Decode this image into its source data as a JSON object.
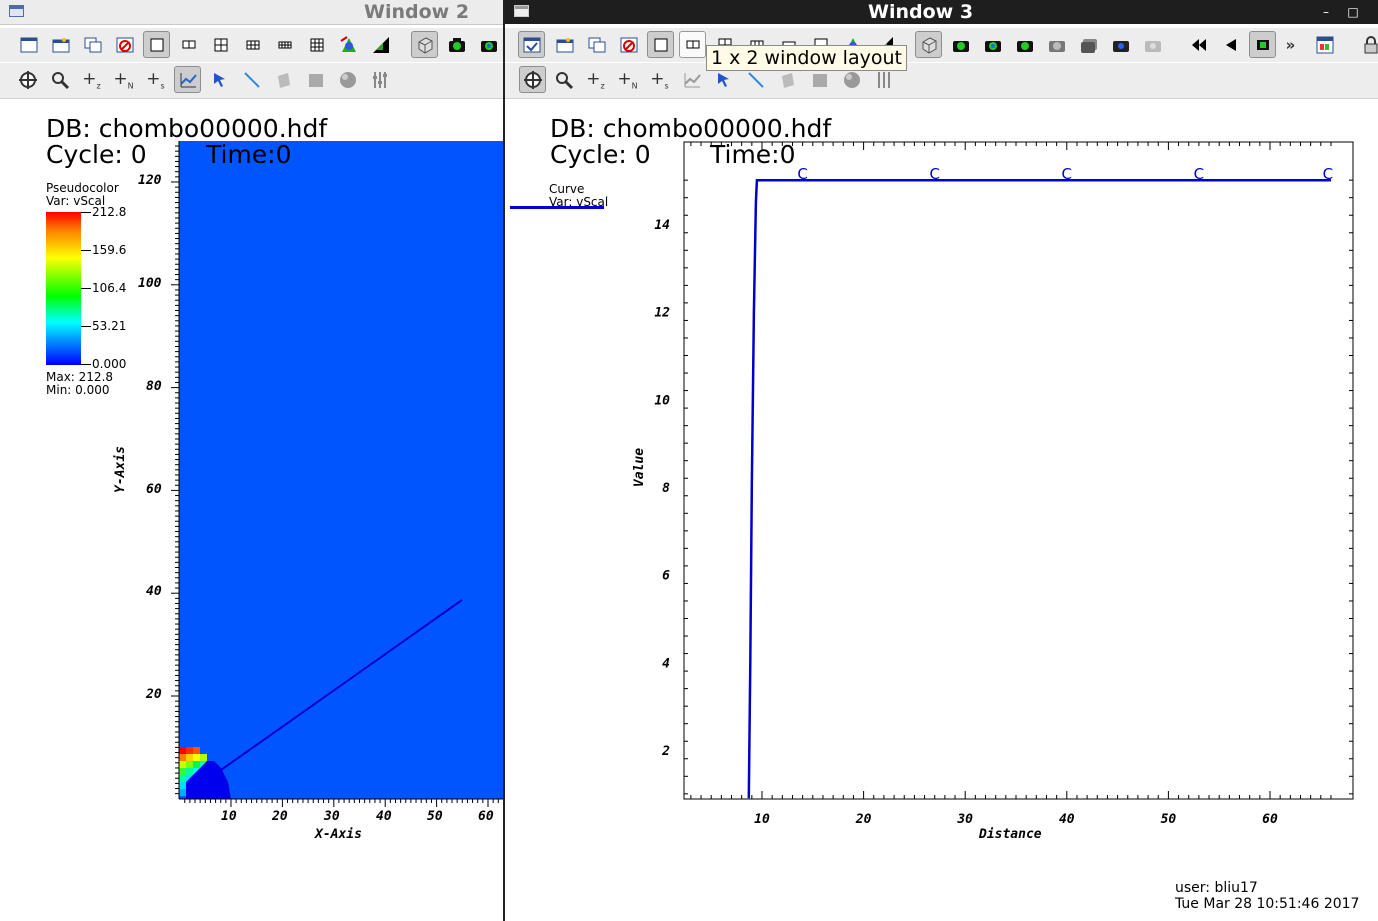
{
  "window2": {
    "title": "Window 2",
    "db": "DB: chombo00000.hdf",
    "cycle": "Cycle: 0",
    "time": "Time:0",
    "legend": {
      "plot_type": "Pseudocolor",
      "var": "Var: vScal",
      "ticks": [
        "212.8",
        "159.6",
        "106.4",
        "53.21",
        "0.000"
      ],
      "max": "Max: 212.8",
      "min": "Min: 0.000"
    },
    "x_ticks": [
      "10",
      "20",
      "30",
      "40",
      "50",
      "60"
    ],
    "y_ticks": [
      "120",
      "100",
      "80",
      "60",
      "40",
      "20"
    ],
    "x_label": "X-Axis",
    "y_label": "Y-Axis",
    "plot_background_color": "#0055ff"
  },
  "window3": {
    "title": "Window 3",
    "db": "DB: chombo00000.hdf",
    "cycle": "Cycle: 0",
    "time": "Time:0",
    "legend": {
      "plot_type": "Curve",
      "var": "Var: vScal"
    },
    "tooltip": "1 x 2 window layout",
    "x_label": "Distance",
    "y_label": "Value",
    "marker_label": "C",
    "user": "user: bliu17",
    "date": "Tue Mar 28 10:51:46 2017",
    "curve_color": "#0000cc",
    "chart_data": {
      "type": "line",
      "xlabel": "Distance",
      "ylabel": "Value",
      "xlim": [
        2.0,
        67.0
      ],
      "ylim": [
        0.9,
        15.3
      ],
      "x_ticks": [
        10,
        20,
        30,
        40,
        50,
        60
      ],
      "y_ticks": [
        2,
        4,
        6,
        8,
        10,
        12,
        14
      ],
      "series": [
        {
          "name": "vScal",
          "points": [
            [
              8.7,
              0.9
            ],
            [
              8.85,
              4.0
            ],
            [
              9.0,
              8.0
            ],
            [
              9.2,
              12.0
            ],
            [
              9.4,
              14.5
            ],
            [
              9.5,
              15.0
            ],
            [
              66.0,
              15.0
            ]
          ],
          "markers_x": [
            14.0,
            27.0,
            40.0,
            53.0,
            65.7
          ],
          "markers_y": 15.0
        }
      ]
    }
  }
}
